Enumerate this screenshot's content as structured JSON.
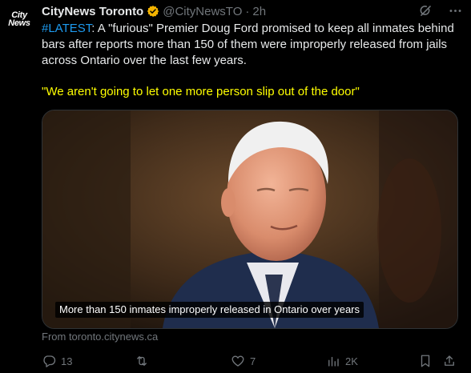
{
  "avatar": {
    "line1": "City",
    "line2": "News"
  },
  "tweet": {
    "author_name": "CityNews Toronto",
    "handle": "@CityNewsTO",
    "separator": "·",
    "time": "2h",
    "hashtag": "#LATEST",
    "body": ": A \"furious\" Premier Doug Ford promised to keep all inmates behind bars after reports more than 150 of them were improperly released from jails across Ontario over the last few years.",
    "quote": "\"We aren't going to let one more person slip out of the door\"",
    "media_caption": "More than 150 inmates improperly released in Ontario over years",
    "source": "From toronto.citynews.ca"
  },
  "actions": {
    "replies": "13",
    "retweets": "",
    "likes": "7",
    "views": "2K"
  },
  "icons": {
    "verified": "verified-badge-icon",
    "grok": "grok-icon",
    "more": "more-icon",
    "reply": "reply-icon",
    "retweet": "retweet-icon",
    "like": "heart-icon",
    "views": "views-icon",
    "bookmark": "bookmark-icon",
    "share": "share-icon"
  },
  "colors": {
    "background": "#000000",
    "text": "#e7e9ea",
    "muted": "#71767b",
    "hashtag": "#1d9bf0",
    "quote": "#ffff00",
    "verified": "#f4b400"
  }
}
